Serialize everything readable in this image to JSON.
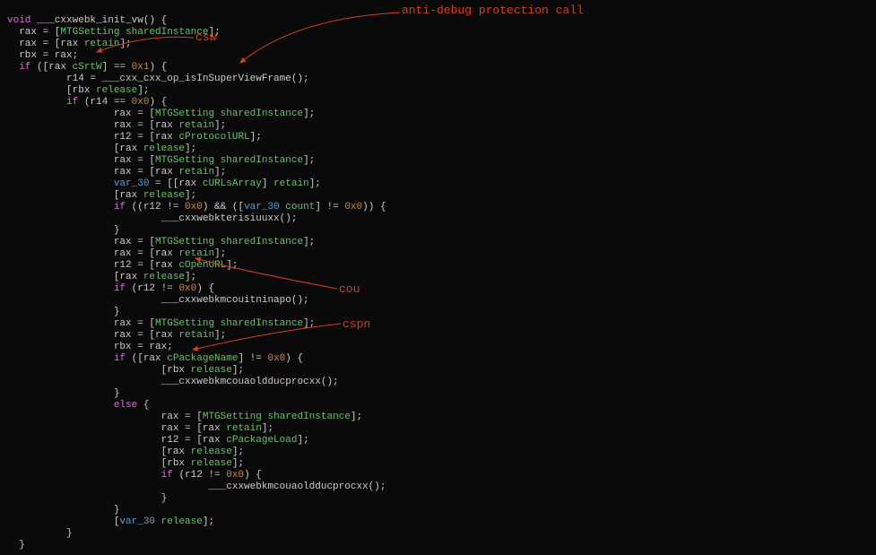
{
  "annotations": {
    "csw": "csw",
    "antidebug": "anti-debug protection call",
    "cou": "cou",
    "cspn": "cspn"
  },
  "code": {
    "l01_a": "void",
    "l01_b": " ___cxxwebk_init_vw() {",
    "l02": "  rax = [",
    "l02_cls": "MTGSetting",
    "l02_b": " ",
    "l02_sel": "sharedInstance",
    "l02_c": "];",
    "l03": "  rax = [rax ",
    "l03_sel": "retain",
    "l03_b": "];",
    "l04": "  rbx = rax;",
    "l05_a": "  ",
    "l05_kw": "if",
    "l05_b": " ([rax ",
    "l05_sel": "cSrtW",
    "l05_c": "] == ",
    "l05_num": "0x1",
    "l05_d": ") {",
    "l06": "          r14 = ___cxx_cxx_op_isInSuperViewFrame();",
    "l07": "          [rbx ",
    "l07_sel": "release",
    "l07_b": "];",
    "l08_a": "          ",
    "l08_kw": "if",
    "l08_b": " (r14 == ",
    "l08_num": "0x0",
    "l08_c": ") {",
    "l09": "                  rax = [",
    "l09_cls": "MTGSetting",
    "l09_b": " ",
    "l09_sel": "sharedInstance",
    "l09_c": "];",
    "l10": "                  rax = [rax ",
    "l10_sel": "retain",
    "l10_b": "];",
    "l11": "                  r12 = [rax ",
    "l11_sel": "cProtocolURL",
    "l11_b": "];",
    "l12": "                  [rax ",
    "l12_sel": "release",
    "l12_b": "];",
    "l13": "                  rax = [",
    "l13_cls": "MTGSetting",
    "l13_b": " ",
    "l13_sel": "sharedInstance",
    "l13_c": "];",
    "l14": "                  rax = [rax ",
    "l14_sel": "retain",
    "l14_b": "];",
    "l15": "                  ",
    "l15_var": "var_30",
    "l15_b": " = [[rax ",
    "l15_sel": "cURLsArray",
    "l15_c": "] ",
    "l15_sel2": "retain",
    "l15_d": "];",
    "l16": "                  [rax ",
    "l16_sel": "release",
    "l16_b": "];",
    "l17_a": "                  ",
    "l17_kw": "if",
    "l17_b": " ((r12 != ",
    "l17_num": "0x0",
    "l17_c": ") && ([",
    "l17_var": "var_30",
    "l17_d": " ",
    "l17_sel": "count",
    "l17_e": "] != ",
    "l17_num2": "0x0",
    "l17_f": ")) {",
    "l18": "                          ___cxxwebkterisiuuxx();",
    "l19": "                  }",
    "l20": "                  rax = [",
    "l20_cls": "MTGSetting",
    "l20_b": " ",
    "l20_sel": "sharedInstance",
    "l20_c": "];",
    "l21": "                  rax = [rax ",
    "l21_sel": "retain",
    "l21_b": "];",
    "l22": "                  r12 = [rax ",
    "l22_sel": "cOpenURL",
    "l22_b": "];",
    "l23": "                  [rax ",
    "l23_sel": "release",
    "l23_b": "];",
    "l24_a": "                  ",
    "l24_kw": "if",
    "l24_b": " (r12 != ",
    "l24_num": "0x0",
    "l24_c": ") {",
    "l25": "                          ___cxxwebkmcouitninapo();",
    "l26": "                  }",
    "l27": "                  rax = [",
    "l27_cls": "MTGSetting",
    "l27_b": " ",
    "l27_sel": "sharedInstance",
    "l27_c": "];",
    "l28": "                  rax = [rax ",
    "l28_sel": "retain",
    "l28_b": "];",
    "l29": "                  rbx = rax;",
    "l30_a": "                  ",
    "l30_kw": "if",
    "l30_b": " ([rax ",
    "l30_sel": "cPackageName",
    "l30_c": "] != ",
    "l30_num": "0x0",
    "l30_d": ") {",
    "l31": "                          [rbx ",
    "l31_sel": "release",
    "l31_b": "];",
    "l32": "                          ___cxxwebkmcouaoldducprocxx();",
    "l33": "                  }",
    "l34_a": "                  ",
    "l34_kw": "else",
    "l34_b": " {",
    "l35": "                          rax = [",
    "l35_cls": "MTGSetting",
    "l35_b": " ",
    "l35_sel": "sharedInstance",
    "l35_c": "];",
    "l36": "                          rax = [rax ",
    "l36_sel": "retain",
    "l36_b": "];",
    "l37": "                          r12 = [rax ",
    "l37_sel": "cPackageLoad",
    "l37_b": "];",
    "l38": "                          [rax ",
    "l38_sel": "release",
    "l38_b": "];",
    "l39": "                          [rbx ",
    "l39_sel": "release",
    "l39_b": "];",
    "l40_a": "                          ",
    "l40_kw": "if",
    "l40_b": " (r12 != ",
    "l40_num": "0x0",
    "l40_c": ") {",
    "l41": "                                  ___cxxwebkmcouaoldducprocxx();",
    "l42": "                          }",
    "l43": "                  }",
    "l44": "                  [",
    "l44_var": "var_30",
    "l44_b": " ",
    "l44_sel": "release",
    "l44_c": "];",
    "l45": "          }",
    "l46": "  }"
  }
}
